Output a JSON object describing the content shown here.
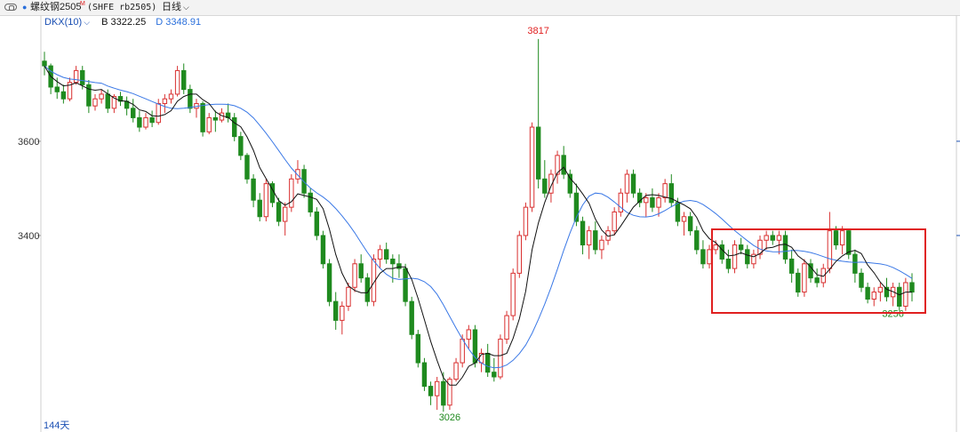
{
  "window": {
    "title_dot": "●",
    "title_name": "螺纹钢2505",
    "title_sup": "M",
    "title_code": "(SHFE rb2505)",
    "period_label": "日线",
    "period_chevron": "⌵"
  },
  "indicator": {
    "name": "DKX(10)",
    "dropdown_icon": "⌵",
    "b_text": "B 3322.25",
    "d_text": "D 3348.91",
    "colors": {
      "b_line": "#111111",
      "d_line": "#3a78e6"
    }
  },
  "footer": {
    "days_label": "144天"
  },
  "highlight_box": {
    "color": "#e02020"
  },
  "chart_data": {
    "type": "candlestick",
    "y_ticks": [
      3400,
      3600
    ],
    "y_range": [
      3000,
      3830
    ],
    "annotations": [
      {
        "kind": "high",
        "text": "3817",
        "index": 78
      },
      {
        "kind": "low",
        "text": "3026",
        "index": 64
      },
      {
        "kind": "low",
        "text": "3256",
        "index": 134
      }
    ],
    "colors": {
      "up": "#d93030",
      "down": "#1f8a1f"
    },
    "ohlc": [
      [
        3770,
        3790,
        3740,
        3760
      ],
      [
        3760,
        3765,
        3700,
        3715
      ],
      [
        3715,
        3735,
        3690,
        3705
      ],
      [
        3705,
        3720,
        3680,
        3690
      ],
      [
        3690,
        3735,
        3685,
        3725
      ],
      [
        3725,
        3760,
        3720,
        3750
      ],
      [
        3750,
        3760,
        3710,
        3720
      ],
      [
        3720,
        3730,
        3660,
        3675
      ],
      [
        3675,
        3700,
        3665,
        3690
      ],
      [
        3690,
        3710,
        3680,
        3700
      ],
      [
        3700,
        3710,
        3660,
        3670
      ],
      [
        3670,
        3700,
        3660,
        3695
      ],
      [
        3695,
        3705,
        3675,
        3685
      ],
      [
        3685,
        3695,
        3655,
        3670
      ],
      [
        3670,
        3690,
        3640,
        3650
      ],
      [
        3650,
        3665,
        3620,
        3630
      ],
      [
        3630,
        3660,
        3625,
        3650
      ],
      [
        3650,
        3665,
        3630,
        3640
      ],
      [
        3640,
        3690,
        3635,
        3680
      ],
      [
        3680,
        3700,
        3660,
        3690
      ],
      [
        3690,
        3710,
        3680,
        3700
      ],
      [
        3700,
        3760,
        3695,
        3750
      ],
      [
        3750,
        3765,
        3700,
        3710
      ],
      [
        3710,
        3720,
        3660,
        3670
      ],
      [
        3670,
        3690,
        3650,
        3680
      ],
      [
        3680,
        3685,
        3610,
        3620
      ],
      [
        3620,
        3660,
        3615,
        3650
      ],
      [
        3650,
        3665,
        3620,
        3645
      ],
      [
        3645,
        3670,
        3640,
        3660
      ],
      [
        3660,
        3680,
        3640,
        3650
      ],
      [
        3650,
        3660,
        3600,
        3610
      ],
      [
        3610,
        3620,
        3560,
        3570
      ],
      [
        3570,
        3575,
        3510,
        3520
      ],
      [
        3520,
        3530,
        3460,
        3475
      ],
      [
        3475,
        3490,
        3430,
        3440
      ],
      [
        3440,
        3520,
        3430,
        3510
      ],
      [
        3510,
        3515,
        3460,
        3470
      ],
      [
        3470,
        3480,
        3420,
        3430
      ],
      [
        3430,
        3470,
        3400,
        3460
      ],
      [
        3460,
        3530,
        3450,
        3520
      ],
      [
        3520,
        3560,
        3510,
        3540
      ],
      [
        3540,
        3550,
        3480,
        3490
      ],
      [
        3490,
        3500,
        3440,
        3450
      ],
      [
        3450,
        3460,
        3390,
        3400
      ],
      [
        3400,
        3410,
        3330,
        3340
      ],
      [
        3340,
        3350,
        3250,
        3260
      ],
      [
        3260,
        3280,
        3200,
        3220
      ],
      [
        3220,
        3260,
        3190,
        3250
      ],
      [
        3250,
        3300,
        3240,
        3290
      ],
      [
        3290,
        3350,
        3280,
        3340
      ],
      [
        3340,
        3360,
        3300,
        3310
      ],
      [
        3310,
        3320,
        3250,
        3260
      ],
      [
        3260,
        3360,
        3250,
        3350
      ],
      [
        3350,
        3380,
        3330,
        3370
      ],
      [
        3370,
        3385,
        3340,
        3350
      ],
      [
        3350,
        3360,
        3300,
        3340
      ],
      [
        3340,
        3360,
        3310,
        3330
      ],
      [
        3330,
        3340,
        3250,
        3260
      ],
      [
        3260,
        3270,
        3180,
        3190
      ],
      [
        3190,
        3200,
        3120,
        3130
      ],
      [
        3130,
        3140,
        3070,
        3080
      ],
      [
        3080,
        3090,
        3040,
        3060
      ],
      [
        3060,
        3100,
        3030,
        3090
      ],
      [
        3090,
        3110,
        3026,
        3040
      ],
      [
        3040,
        3100,
        3030,
        3095
      ],
      [
        3095,
        3140,
        3090,
        3130
      ],
      [
        3130,
        3190,
        3120,
        3180
      ],
      [
        3180,
        3210,
        3160,
        3200
      ],
      [
        3200,
        3210,
        3120,
        3130
      ],
      [
        3130,
        3160,
        3110,
        3150
      ],
      [
        3150,
        3170,
        3100,
        3110
      ],
      [
        3110,
        3140,
        3090,
        3100
      ],
      [
        3100,
        3190,
        3095,
        3180
      ],
      [
        3180,
        3240,
        3170,
        3230
      ],
      [
        3230,
        3330,
        3220,
        3320
      ],
      [
        3320,
        3410,
        3310,
        3400
      ],
      [
        3400,
        3470,
        3390,
        3460
      ],
      [
        3460,
        3640,
        3450,
        3630
      ],
      [
        3630,
        3817,
        3500,
        3520
      ],
      [
        3520,
        3560,
        3480,
        3490
      ],
      [
        3490,
        3540,
        3470,
        3530
      ],
      [
        3530,
        3580,
        3510,
        3570
      ],
      [
        3570,
        3590,
        3520,
        3530
      ],
      [
        3530,
        3540,
        3480,
        3490
      ],
      [
        3490,
        3510,
        3420,
        3430
      ],
      [
        3430,
        3440,
        3360,
        3380
      ],
      [
        3380,
        3420,
        3350,
        3410
      ],
      [
        3410,
        3430,
        3360,
        3370
      ],
      [
        3370,
        3400,
        3350,
        3390
      ],
      [
        3390,
        3420,
        3380,
        3410
      ],
      [
        3410,
        3460,
        3400,
        3450
      ],
      [
        3450,
        3500,
        3440,
        3490
      ],
      [
        3490,
        3540,
        3470,
        3530
      ],
      [
        3530,
        3540,
        3480,
        3490
      ],
      [
        3490,
        3500,
        3460,
        3470
      ],
      [
        3470,
        3490,
        3440,
        3480
      ],
      [
        3480,
        3500,
        3450,
        3460
      ],
      [
        3460,
        3490,
        3440,
        3480
      ],
      [
        3480,
        3520,
        3470,
        3510
      ],
      [
        3510,
        3530,
        3460,
        3470
      ],
      [
        3470,
        3480,
        3420,
        3430
      ],
      [
        3430,
        3450,
        3400,
        3440
      ],
      [
        3440,
        3450,
        3400,
        3410
      ],
      [
        3410,
        3420,
        3360,
        3370
      ],
      [
        3370,
        3390,
        3330,
        3340
      ],
      [
        3340,
        3380,
        3330,
        3370
      ],
      [
        3370,
        3390,
        3360,
        3380
      ],
      [
        3380,
        3390,
        3340,
        3350
      ],
      [
        3350,
        3370,
        3320,
        3330
      ],
      [
        3330,
        3390,
        3320,
        3380
      ],
      [
        3380,
        3395,
        3360,
        3370
      ],
      [
        3370,
        3380,
        3330,
        3340
      ],
      [
        3340,
        3370,
        3330,
        3360
      ],
      [
        3360,
        3400,
        3350,
        3390
      ],
      [
        3390,
        3410,
        3370,
        3400
      ],
      [
        3400,
        3410,
        3380,
        3390
      ],
      [
        3390,
        3410,
        3360,
        3400
      ],
      [
        3400,
        3410,
        3340,
        3350
      ],
      [
        3350,
        3370,
        3300,
        3320
      ],
      [
        3320,
        3330,
        3270,
        3280
      ],
      [
        3280,
        3350,
        3270,
        3340
      ],
      [
        3340,
        3350,
        3300,
        3310
      ],
      [
        3310,
        3330,
        3290,
        3300
      ],
      [
        3300,
        3340,
        3290,
        3330
      ],
      [
        3330,
        3450,
        3320,
        3410
      ],
      [
        3410,
        3420,
        3370,
        3380
      ],
      [
        3380,
        3420,
        3360,
        3410
      ],
      [
        3410,
        3415,
        3350,
        3360
      ],
      [
        3360,
        3370,
        3300,
        3320
      ],
      [
        3320,
        3330,
        3280,
        3290
      ],
      [
        3290,
        3300,
        3256,
        3265
      ],
      [
        3265,
        3290,
        3250,
        3280
      ],
      [
        3280,
        3300,
        3260,
        3290
      ],
      [
        3290,
        3310,
        3260,
        3270
      ],
      [
        3270,
        3300,
        3250,
        3290
      ],
      [
        3290,
        3300,
        3240,
        3250
      ],
      [
        3250,
        3310,
        3240,
        3300
      ],
      [
        3300,
        3320,
        3260,
        3280
      ]
    ]
  }
}
